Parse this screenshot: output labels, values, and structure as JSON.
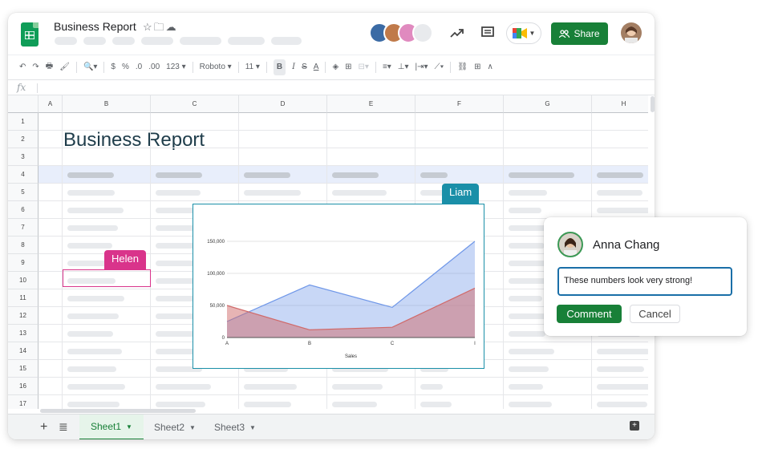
{
  "header": {
    "doc_title": "Business Report",
    "title_icons": [
      "star-icon",
      "folder-move-icon",
      "cloud-icon"
    ],
    "share_label": "Share",
    "collaborators": [
      "#3b6ba5",
      "#c07a4a",
      "#e08abf",
      "#e8eaed"
    ]
  },
  "toolbar": {
    "currency": "$",
    "percent": "%",
    "dec_less": ".0",
    "dec_more": ".00",
    "number_format": "123",
    "font": "Roboto",
    "font_size": "11",
    "bold": "B",
    "italic": "I",
    "strike": "S",
    "text_color": "A"
  },
  "formula_bar": {
    "fx": "fx"
  },
  "grid": {
    "columns": [
      "A",
      "B",
      "C",
      "D",
      "E",
      "F",
      "G",
      "H"
    ],
    "rows": [
      "1",
      "2",
      "3",
      "4",
      "5",
      "6",
      "7",
      "8",
      "9",
      "10",
      "11",
      "12",
      "13",
      "14",
      "15",
      "16",
      "17"
    ],
    "title": "Business Report"
  },
  "collaborator_tags": {
    "liam": "Liam",
    "helen": "Helen"
  },
  "chart_data": {
    "type": "area",
    "categories": [
      "A",
      "B",
      "C",
      "I"
    ],
    "series": [
      {
        "name": "",
        "color": "#6f97e8",
        "values": [
          25000,
          82000,
          47000,
          150000
        ]
      },
      {
        "name": "",
        "color": "#d06a6a",
        "values": [
          50000,
          12000,
          16000,
          77000
        ]
      }
    ],
    "y_ticks": [
      "0",
      "50,000",
      "100,000",
      "150,000"
    ],
    "ylim": [
      0,
      150000
    ],
    "xlabel": "Sales",
    "ylabel": "",
    "title": ""
  },
  "comment": {
    "author": "Anna Chang",
    "text": "These numbers look very strong!",
    "submit_label": "Comment",
    "cancel_label": "Cancel"
  },
  "sheets": {
    "tabs": [
      "Sheet1",
      "Sheet2",
      "Sheet3"
    ],
    "active": "Sheet1"
  },
  "colors": {
    "accent": "#188038",
    "liam": "#1a8fa8",
    "helen": "#d9348b"
  }
}
